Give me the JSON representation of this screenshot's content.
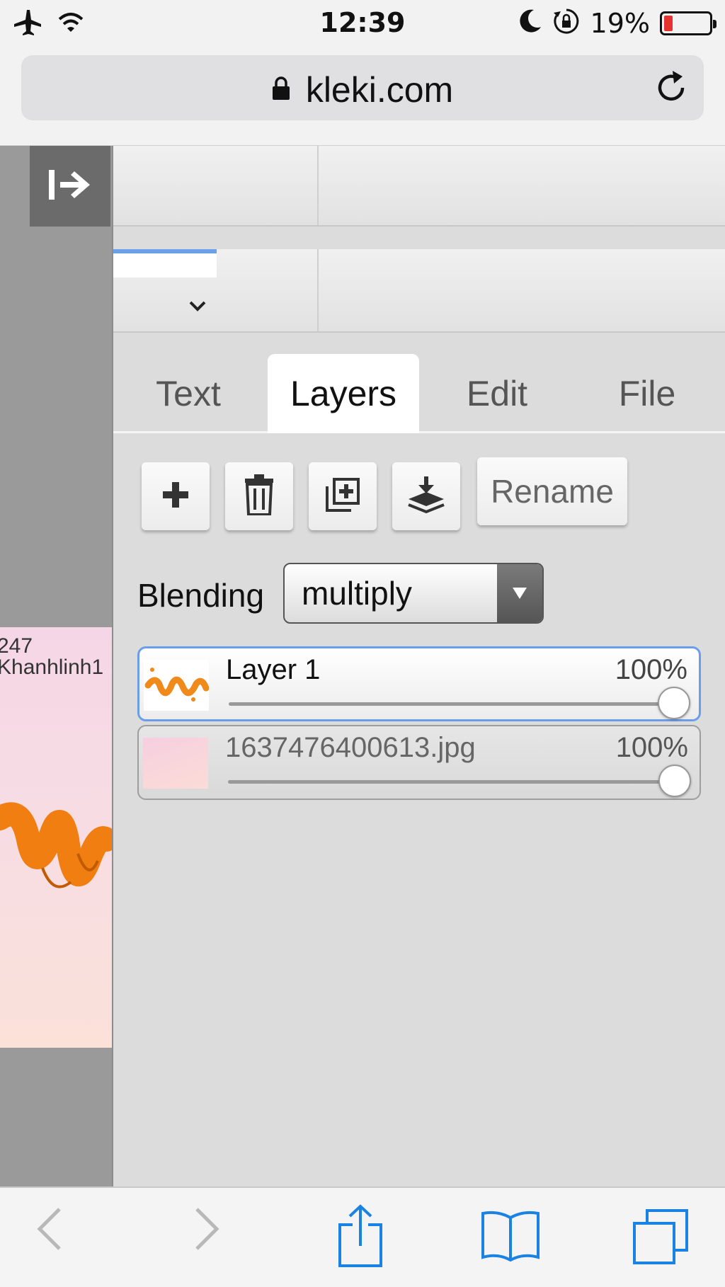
{
  "status_bar": {
    "time": "12:39",
    "battery_text": "19%",
    "battery_level": 0.19
  },
  "browser": {
    "url": "kleki.com"
  },
  "tabs": [
    {
      "label": "Text"
    },
    {
      "label": "Layers"
    },
    {
      "label": "Edit"
    },
    {
      "label": "File"
    }
  ],
  "active_tab": "Layers",
  "layer_actions": {
    "rename_label": "Rename"
  },
  "blending": {
    "label": "Blending",
    "value": "multiply"
  },
  "layers": [
    {
      "name": "Layer 1",
      "opacity_text": "100%",
      "opacity": 1.0,
      "selected": true
    },
    {
      "name": "1637476400613.jpg",
      "opacity_text": "100%",
      "opacity": 1.0,
      "selected": false
    }
  ],
  "canvas": {
    "text_lines": [
      "247",
      "Khanhlinh1"
    ]
  },
  "colors": {
    "accent": "#6c9de8",
    "safari_blue": "#1a82e2",
    "battery_low": "#e5322f"
  }
}
